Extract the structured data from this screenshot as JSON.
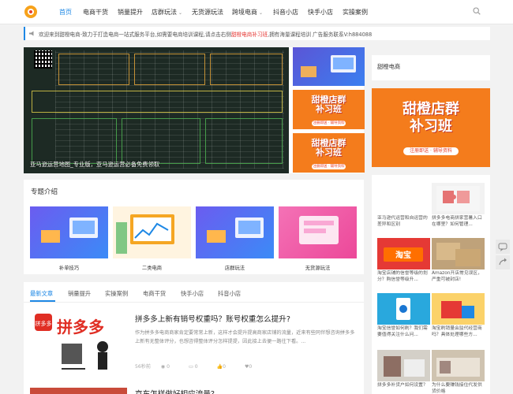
{
  "header": {
    "nav": [
      {
        "label": "首页",
        "active": true
      },
      {
        "label": "电商干货"
      },
      {
        "label": "销量提升"
      },
      {
        "label": "店群玩法",
        "dropdown": true
      },
      {
        "label": "无货源玩法"
      },
      {
        "label": "跨境电商",
        "dropdown": true
      },
      {
        "label": "抖音小店"
      },
      {
        "label": "快手小店"
      },
      {
        "label": "实操案例"
      }
    ]
  },
  "notice": {
    "text_before": "欢迎来到甜橙电商-致力于打造电商一站式服务平台,如需要电商培训课程,请点击右侧",
    "highlight": "甜橙电商补习班",
    "text_after": ",拥有海量课程培训    广告服务联系V:h884088"
  },
  "slider": {
    "caption": "亚马逊运营地图_专业版，亚马逊运营必备免费领取",
    "thumbs": [
      {
        "title": "",
        "subtitle": ""
      },
      {
        "title": "甜橙店群\n补习班",
        "subtitle": "注册即送 · 辅导资料"
      },
      {
        "title": "甜橙店群\n补习班",
        "subtitle": "注册即送 · 辅导资料"
      }
    ]
  },
  "sidebar": {
    "title": "甜橙电商",
    "banner": {
      "title": "甜橙店群\n补习班",
      "subtitle": "注册即送 · 辅导资料"
    },
    "grid": [
      {
        "text": "亚马逊代运营和自运营的差异和区别"
      },
      {
        "text": "拼多多电商拼家营暑入口在哪里？如何管理..."
      },
      {
        "text": "淘宝店铺的信誉等级的划分？购信誉等级升..."
      },
      {
        "text": "Amazon开店常见误区，严重可被封店!"
      },
      {
        "text": "淘宝信誉如何刷？我们需要值得关注什么问..."
      },
      {
        "text": "淘宝刷销量会监代经营商吗？具体处理哪些方..."
      },
      {
        "text": "拼多多补货户如何设置？"
      },
      {
        "text": "为什么要赚钱接住代发供货价格"
      }
    ]
  },
  "topics": {
    "title": "专题介绍",
    "items": [
      {
        "label": "补单技巧"
      },
      {
        "label": "二类电商"
      },
      {
        "label": "店群玩法"
      },
      {
        "label": "无货源玩法"
      }
    ]
  },
  "articles": {
    "tabs": [
      "最新文章",
      "销量提升",
      "实操案例",
      "电商干货",
      "快手小店",
      "抖音小店"
    ],
    "items": [
      {
        "title": "拼多多上新有销号权重吗？账号权重怎么提升?",
        "excerpt": "作为拼多多电商商家肯定要常常上新，这样才会提升提高商家店铺的流量，近来有些同伴想咨询拼多多上新有无整体评分，也想咨得整体评分怎样提提，因此接上去便一路往下看。...",
        "image_text": "拼多多",
        "time": "56秒前",
        "views": "0",
        "likes": "0",
        "comments": "0",
        "favs": "0"
      },
      {
        "title": "京东怎样做好相应流量?"
      }
    ]
  }
}
